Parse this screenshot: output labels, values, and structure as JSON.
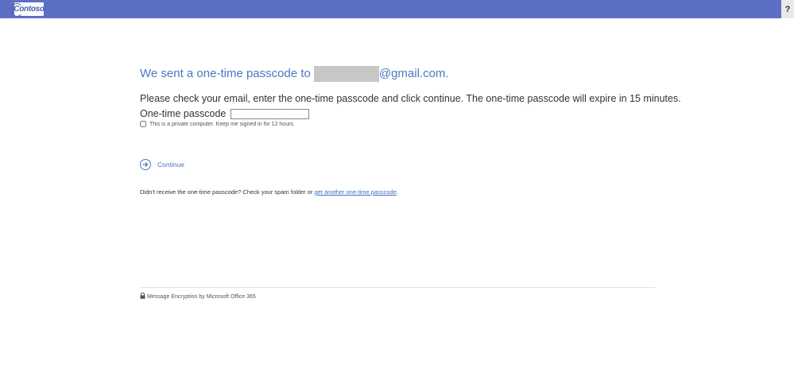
{
  "header": {
    "logo_text": "Contoso",
    "help_label": "?",
    "bar_color": "#5d6fc3"
  },
  "main": {
    "heading_prefix": "We sent a one-time passcode to",
    "heading_suffix": "@gmail.com.",
    "instructions": "Please check your email, enter the one-time passcode and click continue. The one-time passcode will expire in 15 minutes.",
    "otp_label": "One-time passcode",
    "otp_value": "",
    "keep_signed_in_label": "This is a private computer. Keep me signed in for 12 hours.",
    "keep_signed_in_checked": false,
    "continue_label": "Continue",
    "resend_prefix": "Didn't receive the one-time passcode? Check your spam folder or",
    "resend_link": "get another one-time passcode",
    "resend_suffix": "."
  },
  "footer": {
    "text": "Message Encryption by Microsoft Office 365",
    "icon": "lock-icon"
  },
  "colors": {
    "accent": "#4a78c2",
    "link": "#3a6fc0"
  }
}
